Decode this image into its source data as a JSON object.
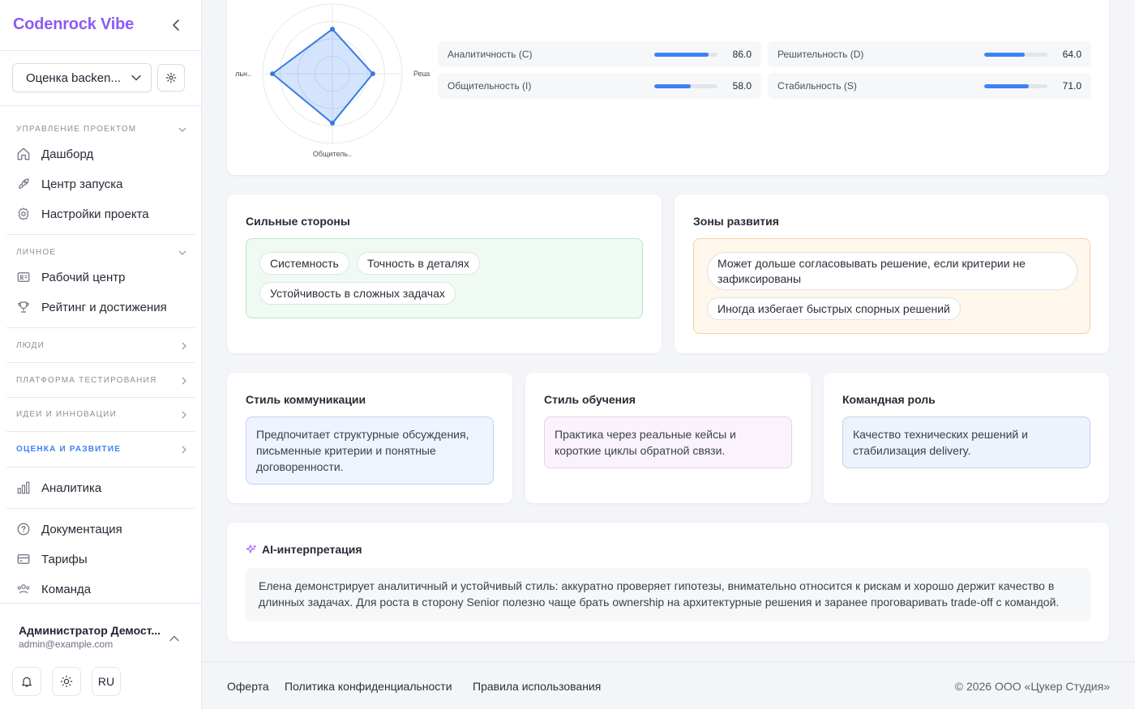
{
  "app": {
    "brand": "Codenrock Vibe"
  },
  "sidebar": {
    "project_select": "Оценка backen...",
    "sections": {
      "project_mgmt": "Управление проектом",
      "personal": "Личное",
      "people": "Люди",
      "testing": "Платформа тестирования",
      "ideas": "Идеи и инновации",
      "assessment": "Оценка и развитие"
    },
    "items": {
      "dashboard": "Дашборд",
      "launch": "Центр запуска",
      "project_settings": "Настройки проекта",
      "workcenter": "Рабочий центр",
      "rating": "Рейтинг и достижения",
      "analytics": "Аналитика",
      "docs": "Документация",
      "plans": "Тарифы",
      "team": "Команда"
    },
    "user": {
      "name": "Администратор Демост...",
      "email": "admin@example.com"
    },
    "lang": "RU"
  },
  "radar": {
    "labels": {
      "top": "",
      "right": "Решит",
      "bottom": "Общитель..",
      "left": "ильн.."
    }
  },
  "chart_data": {
    "type": "radar",
    "axes": [
      "Решительность (D)",
      "Общительность (I)",
      "Стабильность (S)",
      "Аналитичность (C)"
    ],
    "values": [
      64.0,
      58.0,
      71.0,
      86.0
    ],
    "range": [
      0,
      100
    ]
  },
  "metrics": [
    {
      "label": "Аналитичность (C)",
      "value": "86.0",
      "pct": 0.86
    },
    {
      "label": "Решительность (D)",
      "value": "64.0",
      "pct": 0.64
    },
    {
      "label": "Общительность (I)",
      "value": "58.0",
      "pct": 0.58
    },
    {
      "label": "Стабильность (S)",
      "value": "71.0",
      "pct": 0.71
    }
  ],
  "strengths": {
    "title": "Сильные стороны",
    "chips": [
      "Системность",
      "Точность в деталях",
      "Устойчивость в сложных задачах"
    ]
  },
  "growth": {
    "title": "Зоны развития",
    "chips": [
      "Может дольше согласовывать решение, если критерии не зафиксированы",
      "Иногда избегает быстрых спорных решений"
    ]
  },
  "communication": {
    "title": "Стиль коммуникации",
    "text": "Предпочитает структурные обсуждения, письменные критерии и понятные договоренности."
  },
  "learning": {
    "title": "Стиль обучения",
    "text": "Практика через реальные кейсы и короткие циклы обратной связи."
  },
  "team_role": {
    "title": "Командная роль",
    "text": "Качество технических решений и стабилизация delivery."
  },
  "ai": {
    "title": "AI-интерпретация",
    "text": "Елена демонстрирует аналитичный и устойчивый стиль: аккуратно проверяет гипотезы, внимательно относится к рискам и хорошо держит качество в длинных задачах. Для роста в сторону Senior полезно чаще брать ownership на архитектурные решения и заранее проговаривать trade-off с командой."
  },
  "footer": {
    "offer": "Оферта",
    "privacy": "Политика конфиденциальности",
    "terms": "Правила использования",
    "copyright": "© 2026 ООО «Цукер Студия»"
  },
  "colors": {
    "accent": "#3b82f6",
    "brand": "#8b5cf6"
  }
}
